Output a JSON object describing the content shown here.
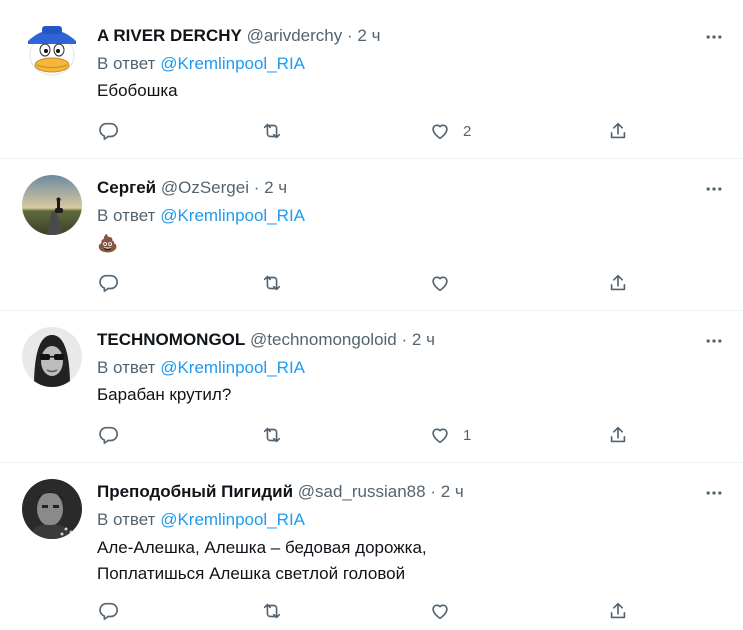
{
  "tweets": [
    {
      "display_name": "A RIVER DERCHY",
      "handle": "@arivderchy",
      "separator": "·",
      "time": "2 ч",
      "reply_prefix": "В ответ",
      "reply_to": "@Kremlinpool_RIA",
      "text_lines": [
        "Ебобошка"
      ],
      "like_count": "2",
      "avatar_icon": "duck-cap-avatar"
    },
    {
      "display_name": "Сергей",
      "handle": "@OzSergei",
      "separator": "·",
      "time": "2 ч",
      "reply_prefix": "В ответ",
      "reply_to": "@Kremlinpool_RIA",
      "text_lines": [
        "💩"
      ],
      "like_count": "",
      "avatar_icon": "sunset-road-avatar"
    },
    {
      "display_name": "TECHNOMONGOL",
      "handle": "@technomongoloid",
      "separator": "·",
      "time": "2 ч",
      "reply_prefix": "В ответ",
      "reply_to": "@Kremlinpool_RIA",
      "text_lines": [
        "Барабан крутил?"
      ],
      "like_count": "1",
      "avatar_icon": "sunglasses-man-avatar"
    },
    {
      "display_name": "Преподобный Пигидий",
      "handle": "@sad_russian88",
      "separator": "·",
      "time": "2 ч",
      "reply_prefix": "В ответ",
      "reply_to": "@Kremlinpool_RIA",
      "text_lines": [
        "Але-Алешка, Алешка – бедовая дорожка,",
        "Поплатишься Алешка светлой головой"
      ],
      "like_count": "",
      "avatar_icon": "monochrome-portrait-avatar"
    }
  ],
  "colors": {
    "text": "#0f1419",
    "secondary": "#536471",
    "accent": "#1d9bf0",
    "divider": "#eff3f4"
  },
  "icons": [
    "reply-icon",
    "retweet-icon",
    "like-icon",
    "share-icon",
    "more-icon"
  ]
}
